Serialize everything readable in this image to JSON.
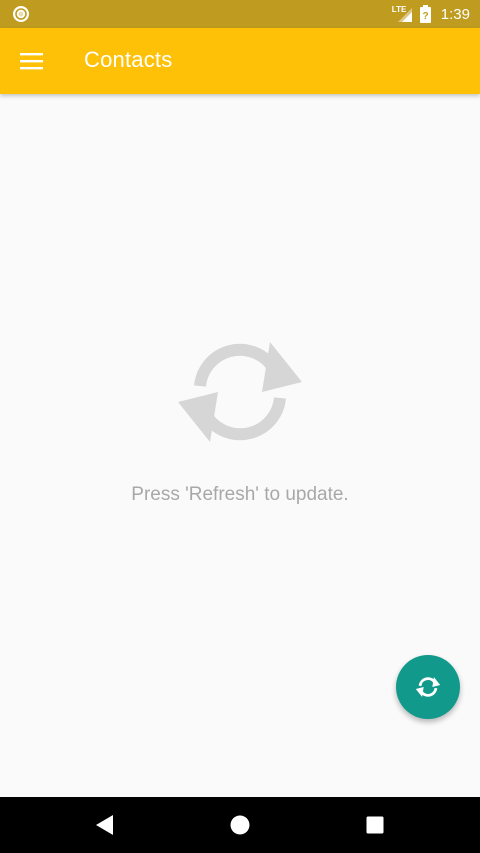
{
  "status_bar": {
    "time": "1:39",
    "network_label": "LTE",
    "icons": [
      "sync-circle-icon",
      "lte-signal-icon",
      "battery-icon"
    ]
  },
  "app_bar": {
    "title": "Contacts",
    "menu_icon": "hamburger-menu-icon",
    "background_color": "#ffc107"
  },
  "empty_state": {
    "icon": "refresh-icon",
    "message": "Press 'Refresh' to update."
  },
  "fab": {
    "icon": "refresh-icon",
    "color": "#119a8c"
  },
  "nav_bar": {
    "buttons": [
      "back-icon",
      "home-icon",
      "recents-icon"
    ]
  },
  "colors": {
    "status_bar": "#bf9c1f",
    "accent": "#ffc107",
    "fab": "#119a8c",
    "empty_text": "#a8a8a8"
  }
}
